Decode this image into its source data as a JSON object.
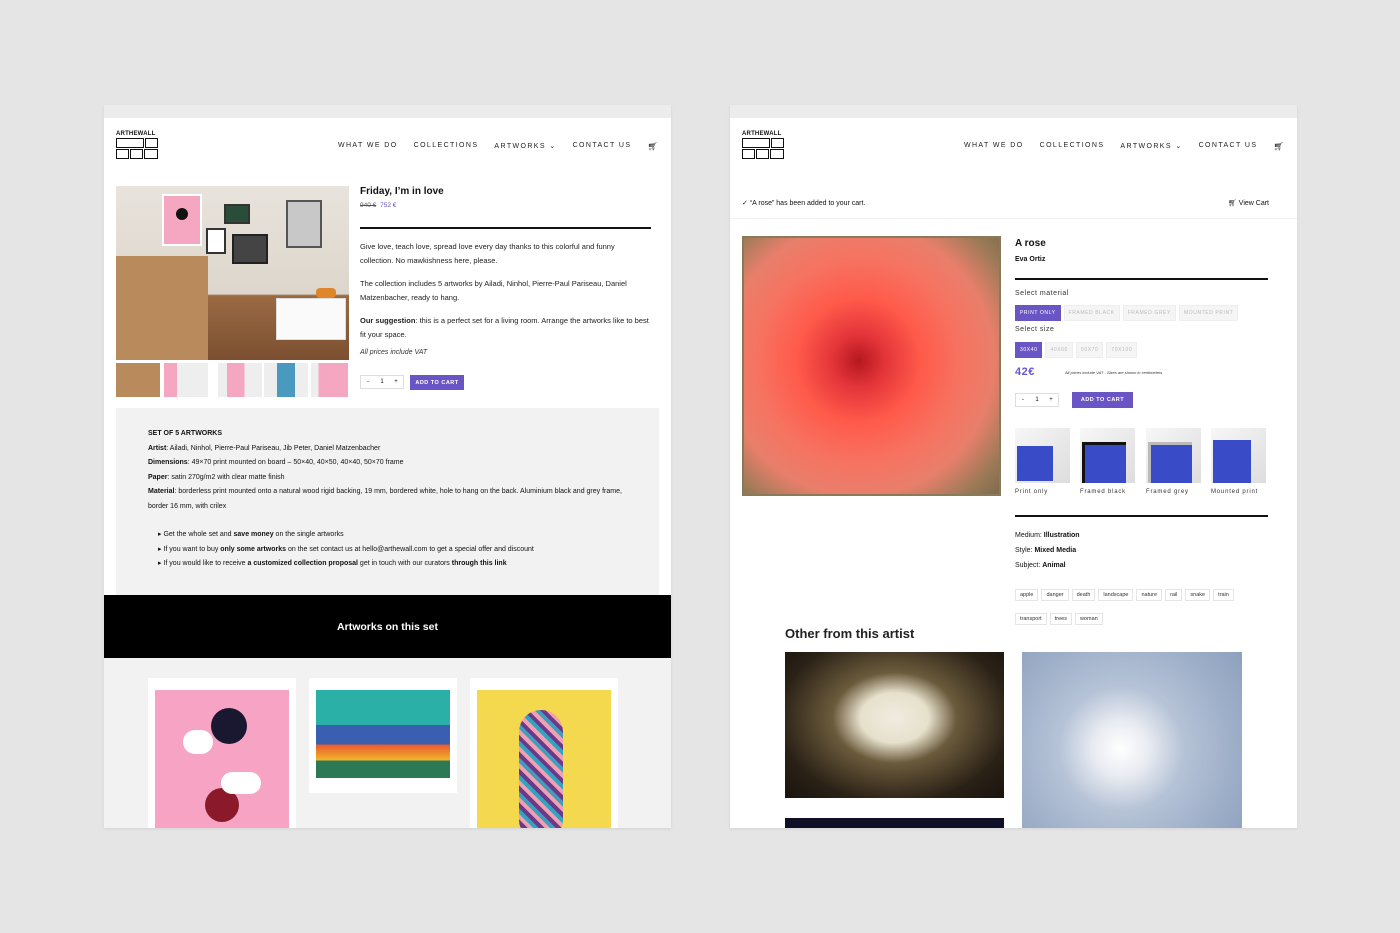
{
  "nav": {
    "logo": "ARTHEWALL",
    "items": [
      "WHAT WE DO",
      "COLLECTIONS",
      "ARTWORKS",
      "CONTACT US"
    ]
  },
  "left": {
    "title": "Friday, I’m in love",
    "price_old": "940 €",
    "price_new": "752 €",
    "desc1": "Give love, teach love, spread love every day thanks to this colorful and funny collection. No mawkishness here, please.",
    "desc2": "The collection includes 5 artworks by Ailadi, Ninhol, Pierre-Paul Pariseau, Daniel Matzenbacher, ready to hang.",
    "suggestion_label": "Our suggestion",
    "suggestion_text": ": this is a perfect set for a living room. Arrange the artworks like to best fit your space.",
    "vat": "All prices include VAT",
    "qty": "1",
    "qty_minus": "-",
    "qty_plus": "+",
    "add_to_cart": "ADD TO CART",
    "details": {
      "heading": "SET OF 5 ARTWORKS",
      "artist_label": "Artist",
      "artist": ": Ailadi, Ninhol, Pierre-Paul Pariseau, Jib Peter, Daniel Matzenbacher",
      "dimensions_label": "Dimensions",
      "dimensions": ": 49×70 print mounted on board – 50×40, 40×50, 40×40, 50×70  frame",
      "paper_label": "Paper",
      "paper": ": satin 270g/m2 with clear matte finish",
      "material_label": "Material",
      "material": ": borderless print mounted onto a natural wood rigid backing, 19 mm, bordered white, hole to hang on the back. Aluminium black and grey frame, border 16 mm, with crilex",
      "b1_pre": "Get the whole set and ",
      "b1_bold": "save money",
      "b1_post": " on the single artworks",
      "b2_pre": "If you want to buy ",
      "b2_bold": "only some artworks",
      "b2_post": " on the set contact us at hello@arthewall.com to get a special offer and discount",
      "b3_pre": "If you would like to receive ",
      "b3_bold": "a customized collection proposal",
      "b3_mid": " get in touch with our curators ",
      "b3_bold2": "through this link"
    },
    "banner": "Artworks on this set"
  },
  "right": {
    "notice": "“A rose” has been added to your cart.",
    "view_cart": "View Cart",
    "title": "A rose",
    "artist": "Eva Ortiz",
    "material_label": "Select material",
    "materials": [
      "PRINT ONLY",
      "FRAMED BLACK",
      "FRAMED GREY",
      "MOUNTED PRINT"
    ],
    "size_label": "Select size",
    "sizes": [
      "30X40",
      "40X60",
      "50X70",
      "70X100"
    ],
    "price": "42€",
    "price_note": "All prices include VAT - Sizes are shown in centimeters",
    "qty": "1",
    "qty_minus": "-",
    "qty_plus": "+",
    "add_to_cart": "ADD TO CART",
    "frames": [
      "Print only",
      "Framed black",
      "Framed grey",
      "Mounted print"
    ],
    "medium_label": "Medium:",
    "medium": "Illustration",
    "style_label": "Style:",
    "style": "Mixed Media",
    "subject_label": "Subject:",
    "subject": "Animal",
    "tags_row1": [
      "apple",
      "danger",
      "death",
      "landscape",
      "nature",
      "rail",
      "snake",
      "train"
    ],
    "tags_row2": [
      "transport",
      "trees",
      "woman"
    ],
    "other_heading": "Other from this artist"
  },
  "colors": {
    "accent": "#6a55c5",
    "background": "#e5e5e5"
  }
}
